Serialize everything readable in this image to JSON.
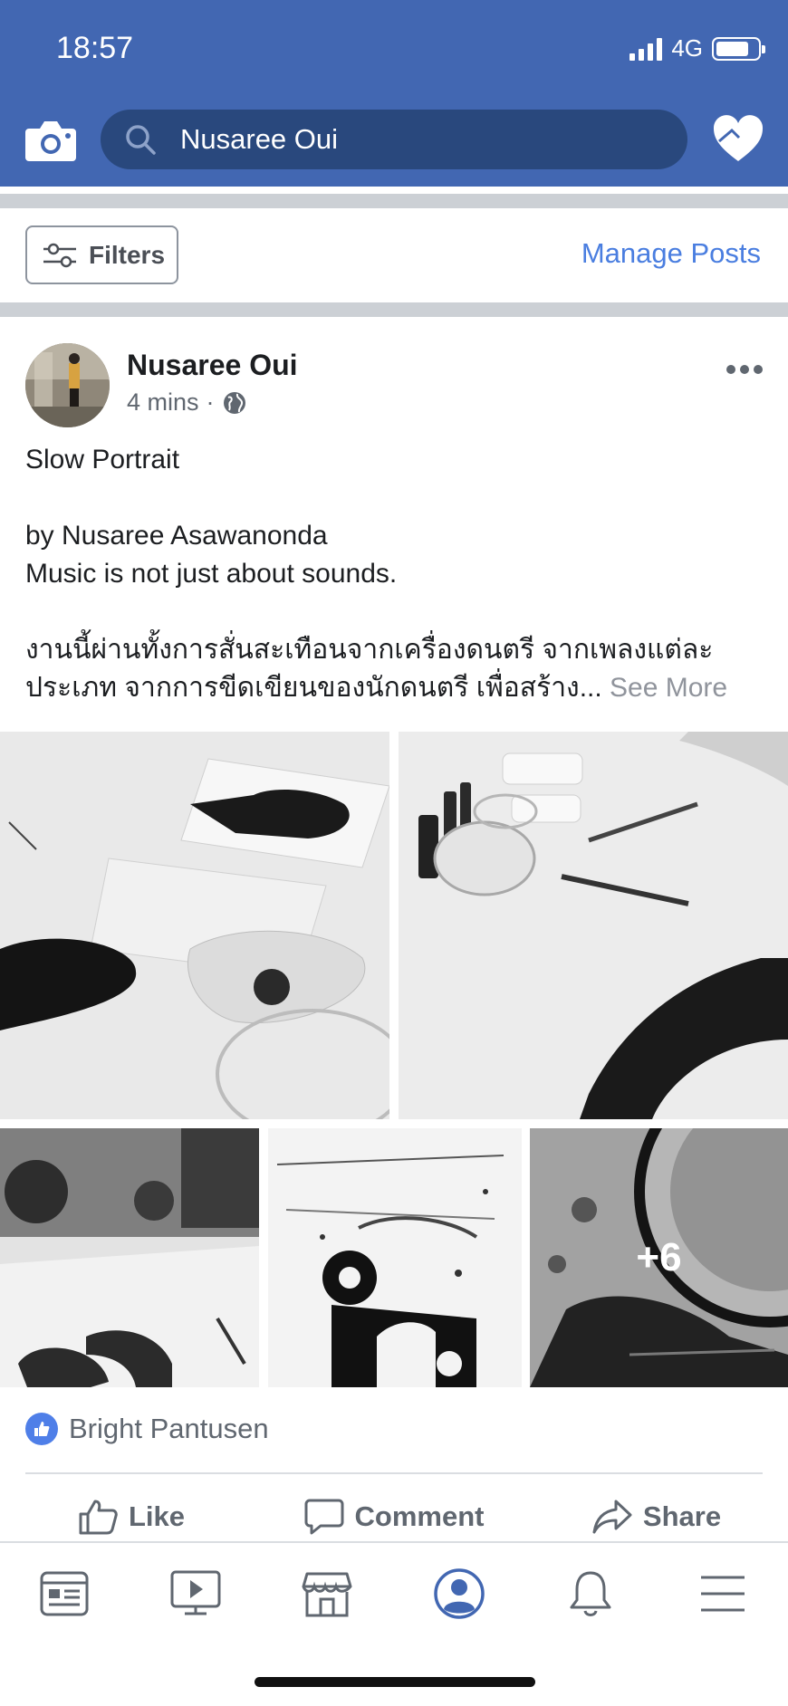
{
  "status_bar": {
    "time": "18:57",
    "network": "4G",
    "battery_level": 0.8
  },
  "header": {
    "search_query": "Nusaree Oui"
  },
  "toolbar": {
    "filters_label": "Filters",
    "manage_posts_label": "Manage Posts"
  },
  "post": {
    "author": "Nusaree Oui",
    "time": "4 mins",
    "privacy_separator": "·",
    "text_lines": [
      "Slow Portrait",
      "by Nusaree Asawanonda",
      "Music is not just about sounds.",
      "งานนี้ผ่านทั้งการสั่นสะเทือนจากเครื่องดนตรี จากเพลงแต่ละ",
      "ประเภท จากการขีดเขียนของนักดนตรี เพื่อสร้าง..."
    ],
    "see_more": "See More",
    "more_photos_count": "+6",
    "reaction_name": "Bright Pantusen",
    "actions": {
      "like": "Like",
      "comment": "Comment",
      "share": "Share"
    }
  },
  "colors": {
    "brand": "#4267b2",
    "link": "#4a7ee0",
    "like_blue": "#4f7fe8"
  },
  "tabs": [
    "news-feed-icon",
    "watch-icon",
    "marketplace-icon",
    "profile-icon",
    "notifications-icon",
    "menu-icon"
  ]
}
